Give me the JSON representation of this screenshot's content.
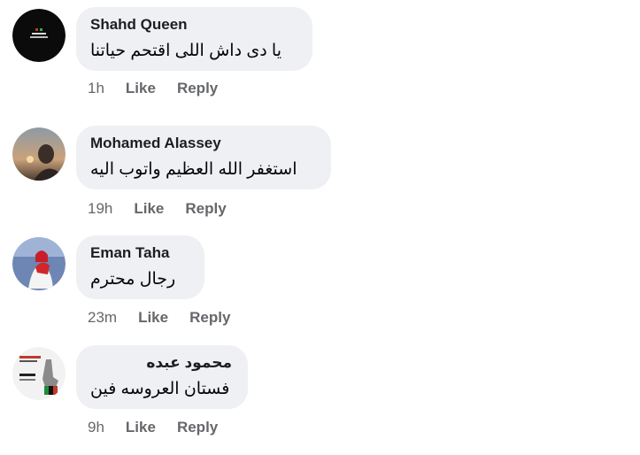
{
  "comments": [
    {
      "author": "Shahd Queen",
      "text": "يا دى داش اللى اقتحم حياتنا",
      "time": "1h",
      "like_label": "Like",
      "reply_label": "Reply"
    },
    {
      "author": "Mohamed Alassey",
      "text": "استغفر الله العظيم واتوب اليه",
      "time": "19h",
      "like_label": "Like",
      "reply_label": "Reply"
    },
    {
      "author": "Eman Taha",
      "text": "رجال محترم",
      "time": "23m",
      "like_label": "Like",
      "reply_label": "Reply"
    },
    {
      "author": "محمود عبده",
      "text": "فستان العروسه فين",
      "time": "9h",
      "like_label": "Like",
      "reply_label": "Reply"
    }
  ]
}
